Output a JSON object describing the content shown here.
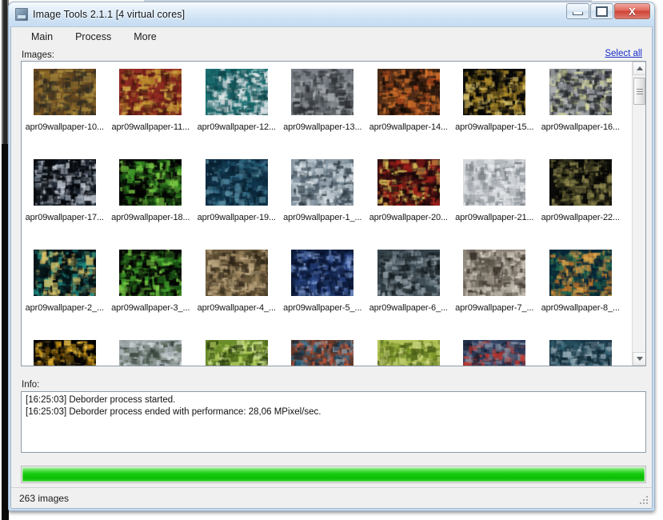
{
  "window": {
    "title": "Image Tools 2.1.1 [4 virtual cores]",
    "icon": "image-tools-app-icon",
    "caption": {
      "minimize": "minimize-icon",
      "maximize": "maximize-icon",
      "close": "X"
    }
  },
  "menu": {
    "items": [
      {
        "label": "Main"
      },
      {
        "label": "Process"
      },
      {
        "label": "More"
      }
    ]
  },
  "images_section": {
    "label": "Images:",
    "select_all_link": "Select all",
    "rows": [
      {
        "cells": [
          {
            "label": "apr09wallpaper-10...",
            "palette": [
              "#6b4a20",
              "#8d6a28",
              "#3b3325",
              "#a98b3e",
              "#2d2a20"
            ]
          },
          {
            "label": "apr09wallpaper-11...",
            "palette": [
              "#8f2b22",
              "#c0922f",
              "#6b1d18",
              "#d8b44a",
              "#451410"
            ]
          },
          {
            "label": "apr09wallpaper-12...",
            "palette": [
              "#1b6f72",
              "#d8dde0",
              "#15575c",
              "#eef1f2",
              "#0d4448"
            ]
          },
          {
            "label": "apr09wallpaper-13...",
            "palette": [
              "#7c8288",
              "#3f4449",
              "#a9aeb2",
              "#5d6266",
              "#2a2d30"
            ]
          },
          {
            "label": "apr09wallpaper-14...",
            "palette": [
              "#4a2b18",
              "#a8471c",
              "#26160c",
              "#d4742c",
              "#120a05"
            ]
          },
          {
            "label": "apr09wallpaper-15...",
            "palette": [
              "#0a0a0a",
              "#b08c2a",
              "#d8c066",
              "#5a4714",
              "#040404"
            ]
          },
          {
            "label": "apr09wallpaper-16...",
            "palette": [
              "#8f9398",
              "#d7d9a0",
              "#2e3135",
              "#b4b7ba",
              "#1a1c1e"
            ]
          }
        ]
      },
      {
        "cells": [
          {
            "label": "apr09wallpaper-17...",
            "palette": [
              "#0a0d12",
              "#cfd6e0",
              "#1d2632",
              "#8e99a6",
              "#05070a"
            ]
          },
          {
            "label": "apr09wallpaper-18...",
            "palette": [
              "#050505",
              "#3f9e2a",
              "#7fd248",
              "#1d5c17",
              "#020202"
            ]
          },
          {
            "label": "apr09wallpaper-19...",
            "palette": [
              "#0d2a3f",
              "#2e6b86",
              "#5b8ea3",
              "#08202f",
              "#11384f"
            ]
          },
          {
            "label": "apr09wallpaper-1_...",
            "palette": [
              "#8a9aa6",
              "#e2e8ec",
              "#4f5f6b",
              "#b9c4cb",
              "#2e3a43"
            ]
          },
          {
            "label": "apr09wallpaper-20...",
            "palette": [
              "#2a0d10",
              "#a8231c",
              "#e0c45a",
              "#5a1412",
              "#120607"
            ]
          },
          {
            "label": "apr09wallpaper-21...",
            "palette": [
              "#d6d9dc",
              "#9aa0a6",
              "#f0f2f4",
              "#6e757b",
              "#b6bbc0"
            ]
          },
          {
            "label": "apr09wallpaper-22...",
            "palette": [
              "#0b0b09",
              "#6d6a38",
              "#9a9256",
              "#3a3a1e",
              "#050504"
            ]
          }
        ]
      },
      {
        "cells": [
          {
            "label": "apr09wallpaper-2_...",
            "palette": [
              "#071418",
              "#1f8f86",
              "#d8c46a",
              "#0c3a3c",
              "#030a0c"
            ]
          },
          {
            "label": "apr09wallpaper-3_...",
            "palette": [
              "#050505",
              "#3f9e2a",
              "#7fd248",
              "#1d5c17",
              "#020202"
            ]
          },
          {
            "label": "apr09wallpaper-4_...",
            "palette": [
              "#6b5a3c",
              "#a89068",
              "#463a26",
              "#c9b48c",
              "#2b2216"
            ]
          },
          {
            "label": "apr09wallpaper-5_...",
            "palette": [
              "#0d1b3a",
              "#2d4a8c",
              "#7f9ed6",
              "#06102a",
              "#1a2f5e"
            ]
          },
          {
            "label": "apr09wallpaper-6_...",
            "palette": [
              "#36434a",
              "#6e7d86",
              "#1c2529",
              "#9aa6ae",
              "#101618"
            ]
          },
          {
            "label": "apr09wallpaper-7_...",
            "palette": [
              "#8e867a",
              "#d6cfc4",
              "#5e574c",
              "#b4ada2",
              "#3a342c"
            ]
          },
          {
            "label": "apr09wallpaper-8_...",
            "palette": [
              "#0a2a3a",
              "#c87a2a",
              "#1f6b52",
              "#e0a648",
              "#062030"
            ]
          }
        ]
      },
      {
        "cells": [
          {
            "label": "",
            "palette": [
              "#050505",
              "#d8a018",
              "#f0c64a",
              "#6b4a08",
              "#020202"
            ]
          },
          {
            "label": "",
            "palette": [
              "#a8b0b4",
              "#5a6a5c",
              "#d2d8da",
              "#36423a",
              "#7f8b86"
            ]
          },
          {
            "label": "",
            "palette": [
              "#6a8c2a",
              "#b4cf5e",
              "#3f5a16",
              "#d8e89a",
              "#25360c"
            ]
          },
          {
            "label": "",
            "palette": [
              "#6b3a2a",
              "#2a6b8c",
              "#c85a3a",
              "#8c9aa6",
              "#1a2a36"
            ]
          },
          {
            "label": "",
            "palette": [
              "#b4c45a",
              "#7f9a2a",
              "#d8e08a",
              "#4a5e16",
              "#5e7520"
            ]
          },
          {
            "label": "",
            "palette": [
              "#2a3a5a",
              "#8a96a8",
              "#c8362a",
              "#4f5e78",
              "#151c2c"
            ]
          },
          {
            "label": "",
            "palette": [
              "#1d3a4a",
              "#5f7f8c",
              "#2a5a6b",
              "#9ab0ba",
              "#0d2430"
            ]
          }
        ]
      }
    ],
    "scrollbar": {
      "up_arrow": "scroll-up-arrow-icon",
      "down_arrow": "scroll-down-arrow-icon"
    }
  },
  "info_section": {
    "label": "Info:",
    "lines": [
      "[16:25:03] Deborder process started.",
      "[16:25:03] Deborder process ended with performance: 28,06 MPixel/sec."
    ]
  },
  "progress": {
    "percent": 100,
    "fill_color": "#14c90c"
  },
  "statusbar": {
    "text": "263 images"
  }
}
